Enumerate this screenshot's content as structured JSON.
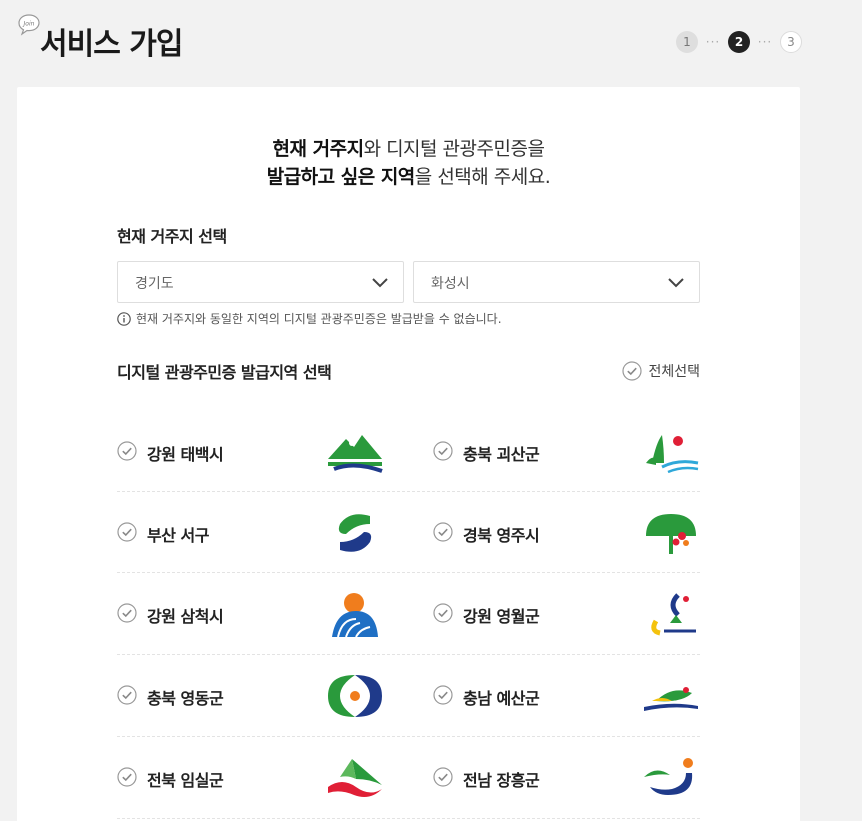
{
  "header": {
    "join_badge": "Join",
    "title": "서비스 가입",
    "steps": [
      "1",
      "2",
      "3"
    ],
    "current_step": 2
  },
  "intro": {
    "line1_bold": "현재 거주지",
    "line1_rest": "와 디지털 관광주민증을",
    "line2_bold": "발급하고 싶은 지역",
    "line2_rest": "을 선택해 주세요."
  },
  "residence": {
    "section_title": "현재 거주지 선택",
    "province_value": "경기도",
    "city_value": "화성시",
    "notice": "현재 거주지와 동일한 지역의 디지털 관광주민증은 발급받을 수 없습니다."
  },
  "issue": {
    "section_title": "디지털 관광주민증 발급지역 선택",
    "select_all_label": "전체선택",
    "regions": [
      {
        "label": "강원 태백시",
        "logo": "taebaek-logo"
      },
      {
        "label": "충북 괴산군",
        "logo": "goesan-logo"
      },
      {
        "label": "부산 서구",
        "logo": "busan-seogu-logo"
      },
      {
        "label": "경북 영주시",
        "logo": "yeongju-logo"
      },
      {
        "label": "강원 삼척시",
        "logo": "samcheok-logo"
      },
      {
        "label": "강원 영월군",
        "logo": "yeongwol-logo"
      },
      {
        "label": "충북 영동군",
        "logo": "yeongdong-logo"
      },
      {
        "label": "충남 예산군",
        "logo": "yesan-logo"
      },
      {
        "label": "전북 임실군",
        "logo": "imsil-logo"
      },
      {
        "label": "전남 장흥군",
        "logo": "jangheung-logo"
      }
    ]
  },
  "colors": {
    "green": "#2a9a3c",
    "navy": "#1f3a8a",
    "orange": "#f07d1d",
    "red": "#e01f36"
  }
}
